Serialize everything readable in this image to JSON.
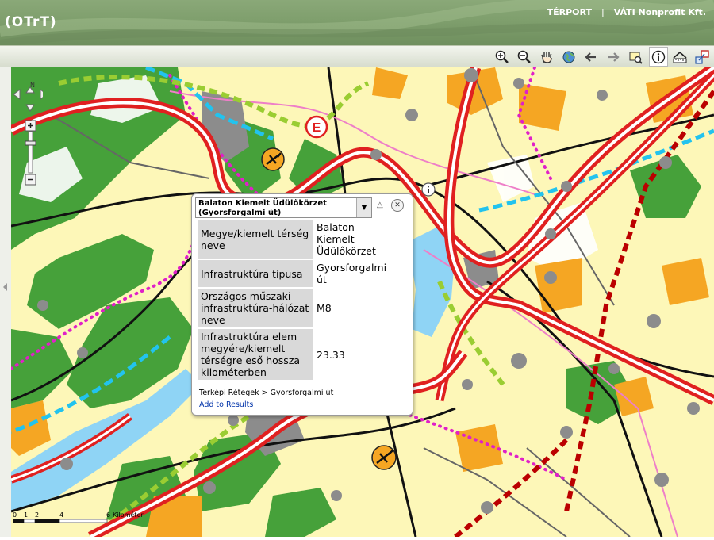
{
  "header": {
    "app_title": "(OTrT)",
    "links": [
      "TÉRPORT",
      "VÁTI Nonprofit Kft."
    ]
  },
  "toolbar": {
    "tools": [
      {
        "name": "zoom-in-icon",
        "active": false
      },
      {
        "name": "zoom-out-icon",
        "active": false
      },
      {
        "name": "pan-hand-icon",
        "active": false
      },
      {
        "name": "full-extent-globe-icon",
        "active": false
      },
      {
        "name": "back-arrow-icon",
        "active": false
      },
      {
        "name": "forward-arrow-icon",
        "active": false
      },
      {
        "name": "select-icon",
        "active": false
      },
      {
        "name": "identify-info-icon",
        "active": true
      },
      {
        "name": "measure-icon",
        "active": false
      },
      {
        "name": "overview-icon",
        "active": false
      }
    ]
  },
  "map": {
    "nav_north": "N",
    "markers": [
      "E"
    ]
  },
  "popup": {
    "title": "Balaton Kiemelt Üdülőkörzet (Gyorsforgalmi út)",
    "rows": [
      {
        "key": "Megye/kiemelt térség neve",
        "value": "Balaton Kiemelt Üdülőkörzet"
      },
      {
        "key": "Infrastruktúra típusa",
        "value": "Gyorsforgalmi út"
      },
      {
        "key": "Országos műszaki infrastruktúra-hálózat neve",
        "value": "M8"
      },
      {
        "key": "Infrastruktúra elem megyére/kiemelt térségre eső hossza kilométerben",
        "value": "23.33"
      }
    ],
    "layer_path": "Térképi Rétegek > Gyorsforgalmi út",
    "add_link": "Add to Results"
  },
  "scalebar": {
    "ticks": [
      "0",
      "1",
      "2",
      "4",
      "6"
    ],
    "unit": "Kilométer"
  }
}
